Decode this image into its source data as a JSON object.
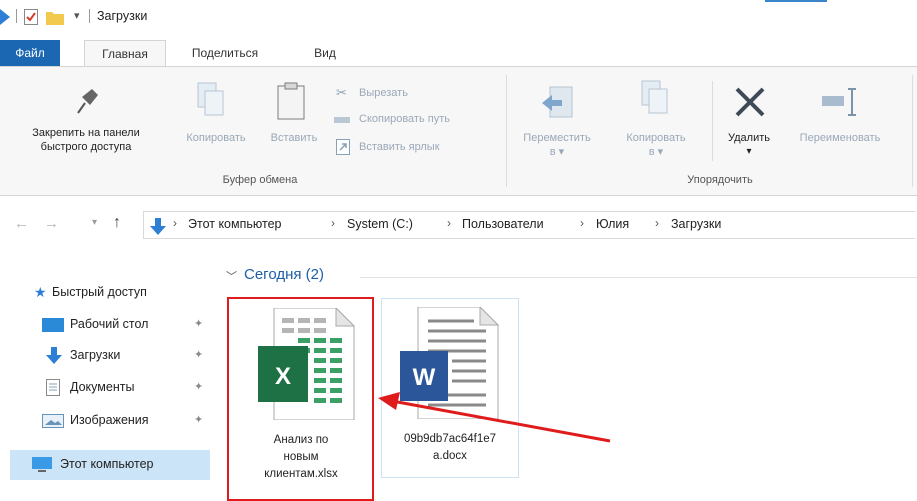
{
  "window": {
    "title": "Загрузки"
  },
  "tabs": [
    {
      "label": "Файл"
    },
    {
      "label": "Главная"
    },
    {
      "label": "Поделиться"
    },
    {
      "label": "Вид"
    }
  ],
  "ribbon": {
    "pin_label_1": "Закрепить на панели",
    "pin_label_2": "быстрого доступа",
    "copy_label": "Копировать",
    "paste_label": "Вставить",
    "cut_label": "Вырезать",
    "copy_path_label": "Скопировать путь",
    "paste_shortcut_label": "Вставить ярлык",
    "clipboard_group": "Буфер обмена",
    "move_to_label_1": "Переместить",
    "move_to_label_2": "в ▾",
    "copy_to_label_1": "Копировать",
    "copy_to_label_2": "в ▾",
    "delete_label": "Удалить",
    "delete_arrow": "▾",
    "rename_label": "Переименовать",
    "organize_group": "Упорядочить"
  },
  "address": {
    "path": [
      "Этот компьютер",
      "System (C:)",
      "Пользователи",
      "Юлия",
      "Загрузки"
    ],
    "separator": "›"
  },
  "nav": {
    "quick_access": "Быстрый доступ",
    "desktop": "Рабочий стол",
    "downloads": "Загрузки",
    "documents": "Документы",
    "pictures": "Изображения",
    "this_pc": "Этот компьютер"
  },
  "content": {
    "group_header": "Сегодня (2)",
    "files": [
      {
        "name_lines": [
          "Анализ по",
          "новым",
          "клиентам.xlsx"
        ],
        "type": "excel-icon"
      },
      {
        "name_lines": [
          "09b9db7ac64f1e7",
          "a.docx"
        ],
        "type": "word-icon"
      }
    ]
  },
  "colors": {
    "file_tab": "#1b67b2",
    "highlight": "#e01b1b",
    "selected_nav": "#cce4f7",
    "excel_green": "#1e7145",
    "word_blue": "#2b579a"
  }
}
